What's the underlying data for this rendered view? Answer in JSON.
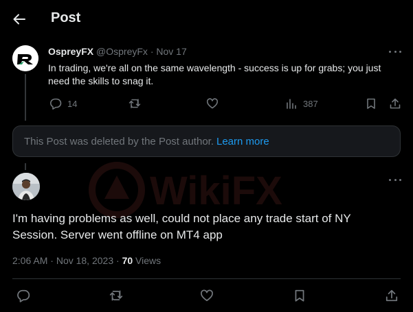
{
  "header": {
    "title": "Post"
  },
  "post1": {
    "author_name": "OspreyFX",
    "handle": "@OspreyFx",
    "separator": "·",
    "date": "Nov 17",
    "text": "In trading, we're all on the same wavelength - success is up for grabs; you just need the skills to snag it.",
    "reply_count": "14",
    "view_count": "387"
  },
  "deleted_notice": {
    "text": "This Post was deleted by the Post author.",
    "link": "Learn more"
  },
  "post2": {
    "text": "I'm having problems as well, could not place any trade start of NY Session. Server went offline on MT4 app",
    "time": "2:06 AM",
    "separator": "·",
    "date": "Nov 18, 2023",
    "separator2": "·",
    "views": "70",
    "views_label": "Views"
  },
  "colors": {
    "background": "#000000",
    "text": "#e7e9ea",
    "muted": "#71767b",
    "link": "#1d9bf0",
    "card": "#16181c",
    "border": "#2f3336"
  },
  "icons": [
    "back-arrow-icon",
    "more-icon",
    "reply-icon",
    "repost-icon",
    "like-icon",
    "views-icon",
    "bookmark-icon",
    "share-icon"
  ]
}
